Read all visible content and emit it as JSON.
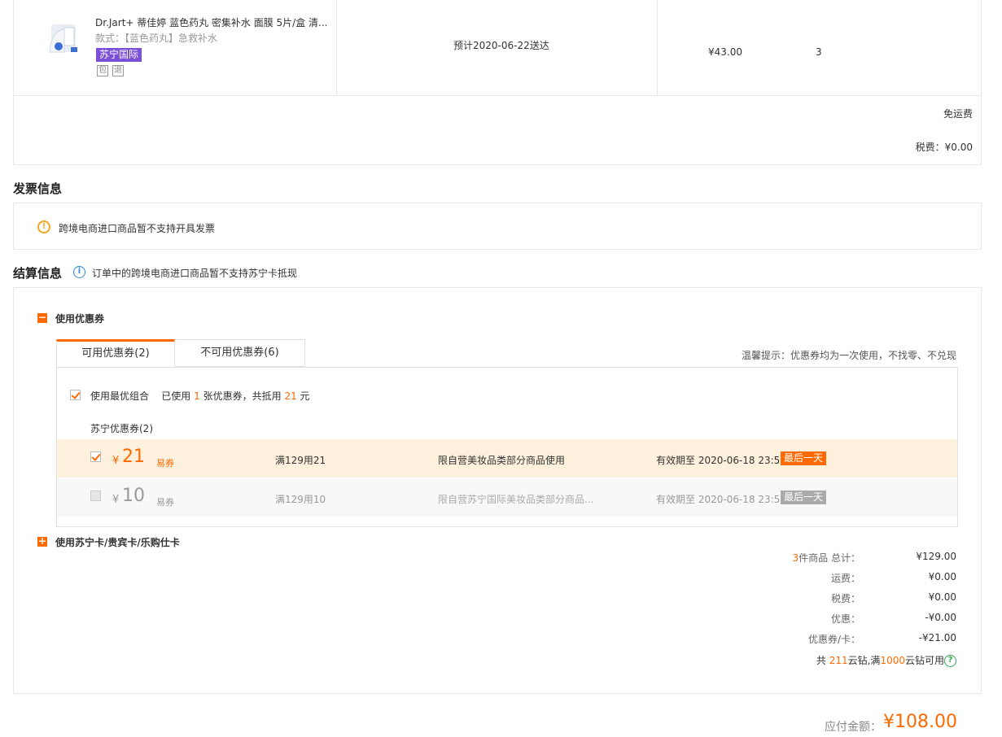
{
  "product": {
    "name": "Dr.Jart+ 蒂佳婷 蓝色药丸 密集补水 面膜 5片/盒 清...",
    "style": "款式：【蓝色药丸】急救补水",
    "tag": "苏宁国际",
    "mini_tags": [
      "包",
      "退"
    ],
    "delivery": "预计2020-06-22送达",
    "price": "¥43.00",
    "quantity": "3",
    "shipping": "免运费",
    "tax": "税费：¥0.00"
  },
  "invoice": {
    "title": "发票信息",
    "notice": "跨境电商进口商品暂不支持开具发票"
  },
  "settlement": {
    "title": "结算信息",
    "notice": "订单中的跨境电商进口商品暂不支持苏宁卡抵现",
    "coupon_section_label": "使用优惠券",
    "tabs": [
      {
        "label": "可用优惠券(2)",
        "active": true
      },
      {
        "label": "不可用优惠券(6)",
        "active": false
      }
    ],
    "tip": "温馨提示：优惠券均为一次使用，不找零、不兑现",
    "best_combo": {
      "label": "使用最优组合",
      "used_prefix": "已使用",
      "used_count": "1",
      "used_middle": "张优惠券，共抵用",
      "used_amount": "21",
      "used_suffix": "元"
    },
    "group_label": "苏宁优惠券(2)",
    "coupons": [
      {
        "currency": "¥",
        "amount": "21",
        "type": "易券",
        "condition": "满129用21",
        "scope": "限自营美妆品类部分商品使用",
        "valid": "有效期至 2020-06-18 23:59",
        "badge": "最后一天",
        "selected": true
      },
      {
        "currency": "¥",
        "amount": "10",
        "type": "易券",
        "condition": "满129用10",
        "scope": "限自营苏宁国际美妆品类部分商品...",
        "valid": "有效期至 2020-06-18 23:59",
        "badge": "最后一天",
        "selected": false
      }
    ],
    "card_section_label": "使用苏宁卡/贵宾卡/乐购仕卡",
    "colors": {
      "accent": "#ff6a00",
      "tag_purple": "#7b4fd6",
      "disabled_badge": "#aaaaaa",
      "selected_row_bg": "#fdf0dc"
    }
  },
  "summary": {
    "items_count": "3",
    "items_label": "件商品 总计：",
    "total": "¥129.00",
    "shipping_label": "运费：",
    "shipping": "¥0.00",
    "tax_label": "税费：",
    "tax": "¥0.00",
    "discount_label": "优惠：",
    "discount": "-¥0.00",
    "coupon_card_label": "优惠券/卡：",
    "coupon_card": "-¥21.00",
    "yunzuan_prefix": "共",
    "yunzuan_have": "211",
    "yunzuan_mid": "云钻,满",
    "yunzuan_need": "1000",
    "yunzuan_suffix": "云钻可用"
  },
  "payable": {
    "label": "应付金额：",
    "amount": "¥108.00"
  }
}
